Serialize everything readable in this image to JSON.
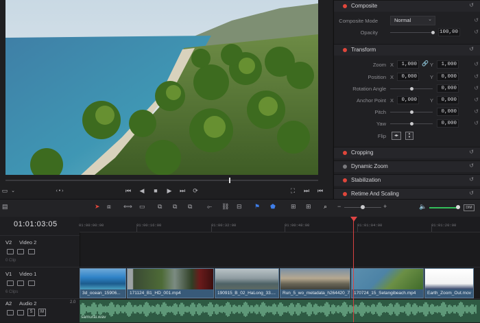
{
  "transport": {
    "left_icon": "screen-icon",
    "nav_label": "‹ • ›",
    "buttons": [
      "⏮",
      "◀",
      "■",
      "▶",
      "⏭",
      "⟳"
    ],
    "right_icons": [
      "⛶",
      "⏭",
      "⏮"
    ]
  },
  "inspector": {
    "composite": {
      "title": "Composite",
      "mode_label": "Composite Mode",
      "mode_value": "Normal",
      "opacity_label": "Opacity",
      "opacity_value": "100,00"
    },
    "transform": {
      "title": "Transform",
      "zoom_label": "Zoom",
      "zoom_x": "1,000",
      "zoom_y": "1,000",
      "position_label": "Position",
      "position_x": "0,000",
      "position_y": "0,000",
      "rotation_label": "Rotation Angle",
      "rotation_value": "0,000",
      "anchor_label": "Anchor Point",
      "anchor_x": "0,000",
      "anchor_y": "0,000",
      "pitch_label": "Pitch",
      "pitch_value": "0,000",
      "yaw_label": "Yaw",
      "yaw_value": "0,000",
      "flip_label": "Flip",
      "x_axis": "X",
      "y_axis": "Y"
    },
    "sections": [
      "Cropping",
      "Dynamic Zoom",
      "Stabilization",
      "Retime And Scaling"
    ]
  },
  "timeline": {
    "timecode": "01:01:03:05",
    "ruler_ticks": [
      "01:00:00:00",
      "01:00:16:00",
      "01:00:32:00",
      "01:00:48:00",
      "01:01:04:00",
      "01:01:20:00"
    ],
    "tracks": {
      "v2": {
        "id": "V2",
        "name": "Video 2",
        "clips": "0 Clip"
      },
      "v1": {
        "id": "V1",
        "name": "Video 1",
        "clips": "6 Clips"
      },
      "a2": {
        "id": "A2",
        "name": "Audio 2",
        "level": "2.0",
        "s": "S",
        "m": "M"
      }
    },
    "video_clips": [
      "3d_ocean_15906...",
      "171124_B1_HD_001.mp4",
      "190915_B_02_HaLong_33....",
      "Run_5_wo_metadata_h264420_7...",
      "170724_15_Setangibeach.mp4",
      "Earth_Zoom_Out.mov"
    ],
    "audio_clip": "samurai.wav"
  },
  "colors": {
    "accent_red": "#e0463b",
    "clip_blue": "#385a79",
    "audio_green": "#2e5a43",
    "playhead": "#d94242"
  }
}
